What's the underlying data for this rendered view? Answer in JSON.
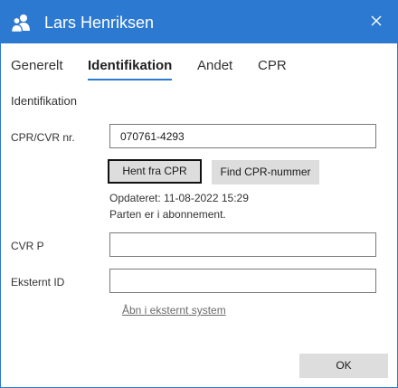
{
  "window": {
    "title": "Lars Henriksen",
    "accent_color": "#2b79d0",
    "app_icon": "people-icon",
    "close_icon": "close-icon"
  },
  "tabs": [
    {
      "label": "Generelt",
      "active": false
    },
    {
      "label": "Identifikation",
      "active": true
    },
    {
      "label": "Andet",
      "active": false
    },
    {
      "label": "CPR",
      "active": false
    }
  ],
  "section": {
    "heading": "Identifikation"
  },
  "cpr_field": {
    "label": "CPR/CVR nr.",
    "value": "070761-4293"
  },
  "buttons": {
    "fetch_cpr": "Hent fra CPR",
    "find_cpr": "Find CPR-nummer"
  },
  "status": {
    "updated": "Opdateret: 11-08-2022 15:29",
    "subscription": "Parten er i abonnement."
  },
  "cvr_p_field": {
    "label": "CVR P",
    "value": ""
  },
  "external_id_field": {
    "label": "Eksternt ID",
    "value": ""
  },
  "external_link": "Åbn i eksternt system",
  "footer": {
    "ok_label": "OK"
  }
}
